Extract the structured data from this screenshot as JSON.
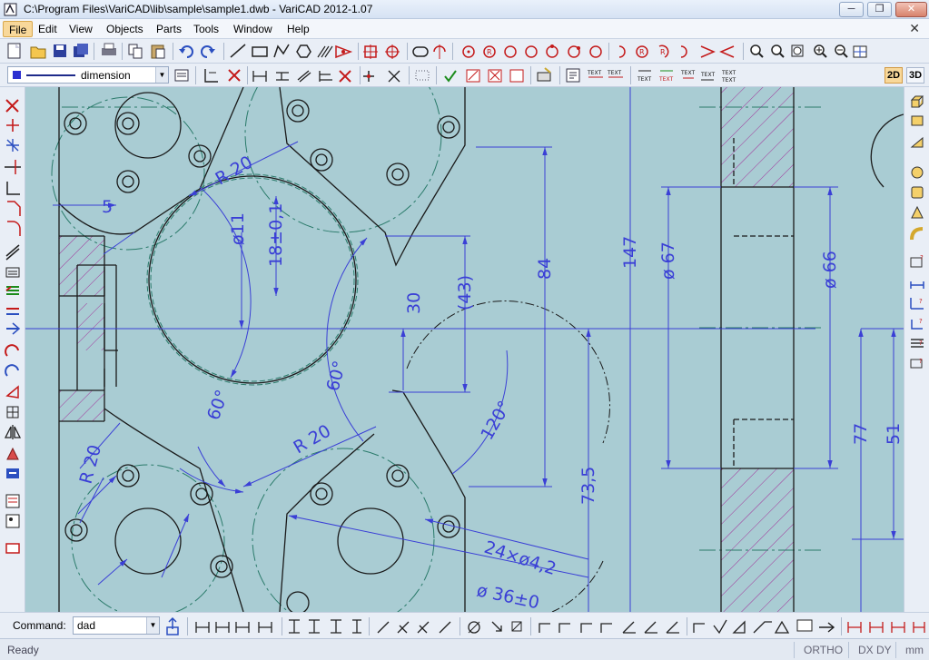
{
  "window": {
    "title": "C:\\Program Files\\VariCAD\\lib\\sample\\sample1.dwb - VariCAD 2012-1.07",
    "min_glyph": "─",
    "max_glyph": "❐",
    "close_glyph": "✕"
  },
  "menu": {
    "items": [
      "File",
      "Edit",
      "View",
      "Objects",
      "Parts",
      "Tools",
      "Window",
      "Help"
    ],
    "active": "File",
    "doc_close_glyph": "✕"
  },
  "layer": {
    "value": "dimension",
    "color": "#2b2fd0"
  },
  "view_modes": {
    "mode_2d": "2D",
    "mode_3d": "3D",
    "active": "2D"
  },
  "drawing": {
    "dimensions": {
      "r20_top": "R 20",
      "d11": "ø11",
      "d18": "18±0,1",
      "d30": "30",
      "d43": "(43)",
      "d84": "84",
      "d147": "147",
      "d67": "ø 67",
      "d66": "ø 66",
      "d5": "5",
      "r20_left": "R 20",
      "a60_left": "60°",
      "a60_mid": "60°",
      "r20_mid": "R 20",
      "a120": "120°",
      "d73_5": "73,5",
      "d77": "77",
      "d51": "51",
      "holes": "24×ø4,2",
      "d36": "ø 36±0"
    },
    "colors": {
      "background": "#a9ccd3",
      "geometry": "#1a1a1a",
      "dimension": "#3a3fd6",
      "centerline": "#2a7a6a",
      "hatch": "#a2329a"
    }
  },
  "command": {
    "label": "Command:",
    "value": "dad"
  },
  "status": {
    "text": "Ready",
    "ortho": "ORTHO",
    "dxdy": "DX DY",
    "units": "mm"
  }
}
